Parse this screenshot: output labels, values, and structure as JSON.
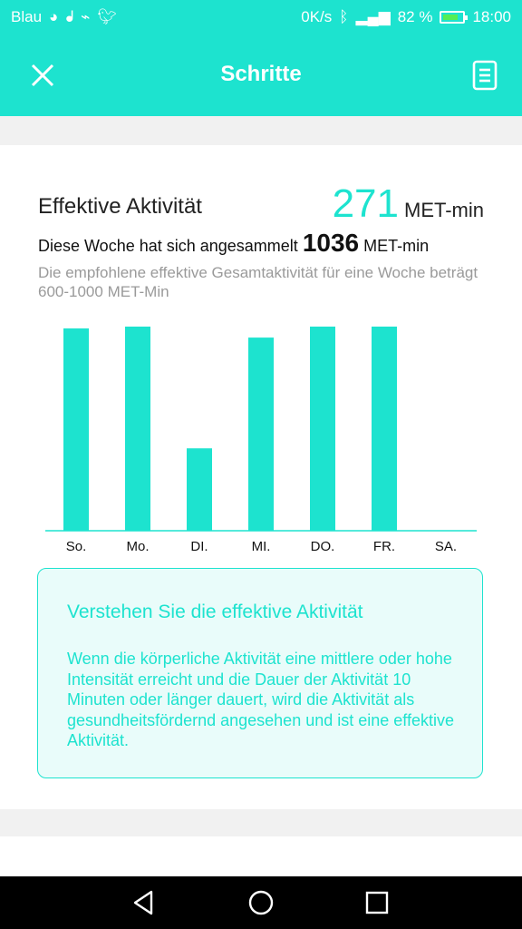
{
  "status_bar": {
    "carrier": "Blau",
    "speed": "0K/s",
    "battery_percent": "82 %",
    "time": "18:00",
    "battery_level": 0.82
  },
  "header": {
    "title": "Schritte"
  },
  "activity": {
    "title": "Effektive Aktivität",
    "value": "271",
    "unit": "MET-min",
    "week_prefix": "Diese Woche hat sich angesammelt",
    "week_value": "1036",
    "week_unit": "MET-min",
    "recommendation": "Die empfohlene effektive Gesamtaktivität für eine Woche beträgt 600-1000 MET-Min"
  },
  "chart_data": {
    "type": "bar",
    "categories": [
      "So.",
      "Mo.",
      "DI.",
      "MI.",
      "DO.",
      "FR.",
      "SA."
    ],
    "values": [
      221,
      223,
      90,
      211,
      223,
      223,
      0
    ],
    "title": "",
    "xlabel": "",
    "ylabel": "",
    "grid": false,
    "color": "#1de3cf"
  },
  "info": {
    "title": "Verstehen Sie die effektive Aktivität",
    "text": "Wenn die körperliche Aktivität eine mittlere oder hohe Intensität erreicht und die Dauer der Aktivität 10 Minuten oder länger dauert, wird die Aktivität als gesundheitsfördernd angesehen und ist eine effektive Aktivität."
  },
  "colors": {
    "accent": "#1de3cf",
    "text": "#222222",
    "muted": "#9a9a9a"
  }
}
